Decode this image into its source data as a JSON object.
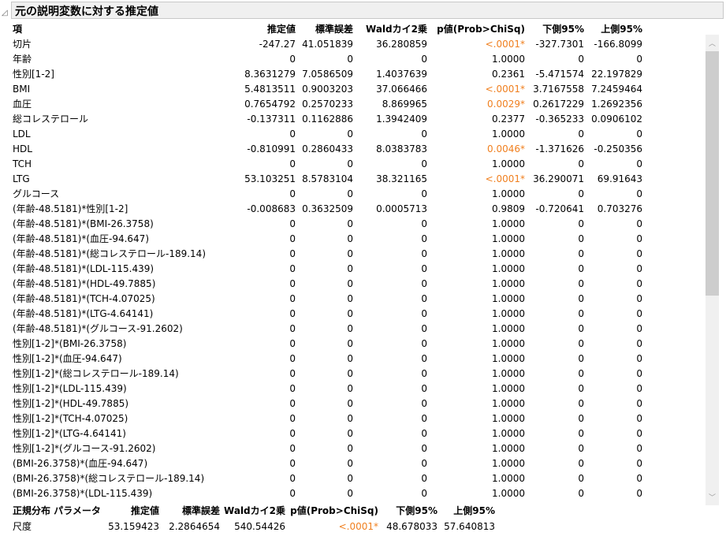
{
  "title": "元の説明変数に対する推定値",
  "columns": [
    "項",
    "推定値",
    "標準誤差",
    "Waldカイ2乗",
    "p値(Prob>ChiSq)",
    "下側95%",
    "上側95%"
  ],
  "rows": [
    [
      "切片",
      "-247.27",
      "41.051839",
      "36.280859",
      "<.0001*",
      "-327.7301",
      "-166.8099"
    ],
    [
      "年齢",
      "0",
      "0",
      "0",
      "1.0000",
      "0",
      "0"
    ],
    [
      "性別[1-2]",
      "8.3631279",
      "7.0586509",
      "1.4037639",
      "0.2361",
      "-5.471574",
      "22.197829"
    ],
    [
      "BMI",
      "5.4813511",
      "0.9003203",
      "37.066466",
      "<.0001*",
      "3.7167558",
      "7.2459464"
    ],
    [
      "血圧",
      "0.7654792",
      "0.2570233",
      "8.869965",
      "0.0029*",
      "0.2617229",
      "1.2692356"
    ],
    [
      "総コレステロール",
      "-0.137311",
      "0.1162886",
      "1.3942409",
      "0.2377",
      "-0.365233",
      "0.0906102"
    ],
    [
      "LDL",
      "0",
      "0",
      "0",
      "1.0000",
      "0",
      "0"
    ],
    [
      "HDL",
      "-0.810991",
      "0.2860433",
      "8.0383783",
      "0.0046*",
      "-1.371626",
      "-0.250356"
    ],
    [
      "TCH",
      "0",
      "0",
      "0",
      "1.0000",
      "0",
      "0"
    ],
    [
      "LTG",
      "53.103251",
      "8.5783104",
      "38.321165",
      "<.0001*",
      "36.290071",
      "69.91643"
    ],
    [
      "グルコース",
      "0",
      "0",
      "0",
      "1.0000",
      "0",
      "0"
    ],
    [
      "(年齢-48.5181)*性別[1-2]",
      "-0.008683",
      "0.3632509",
      "0.0005713",
      "0.9809",
      "-0.720641",
      "0.703276"
    ],
    [
      "(年齢-48.5181)*(BMI-26.3758)",
      "0",
      "0",
      "0",
      "1.0000",
      "0",
      "0"
    ],
    [
      "(年齢-48.5181)*(血圧-94.647)",
      "0",
      "0",
      "0",
      "1.0000",
      "0",
      "0"
    ],
    [
      "(年齢-48.5181)*(総コレステロール-189.14)",
      "0",
      "0",
      "0",
      "1.0000",
      "0",
      "0"
    ],
    [
      "(年齢-48.5181)*(LDL-115.439)",
      "0",
      "0",
      "0",
      "1.0000",
      "0",
      "0"
    ],
    [
      "(年齢-48.5181)*(HDL-49.7885)",
      "0",
      "0",
      "0",
      "1.0000",
      "0",
      "0"
    ],
    [
      "(年齢-48.5181)*(TCH-4.07025)",
      "0",
      "0",
      "0",
      "1.0000",
      "0",
      "0"
    ],
    [
      "(年齢-48.5181)*(LTG-4.64141)",
      "0",
      "0",
      "0",
      "1.0000",
      "0",
      "0"
    ],
    [
      "(年齢-48.5181)*(グルコース-91.2602)",
      "0",
      "0",
      "0",
      "1.0000",
      "0",
      "0"
    ],
    [
      "性別[1-2]*(BMI-26.3758)",
      "0",
      "0",
      "0",
      "1.0000",
      "0",
      "0"
    ],
    [
      "性別[1-2]*(血圧-94.647)",
      "0",
      "0",
      "0",
      "1.0000",
      "0",
      "0"
    ],
    [
      "性別[1-2]*(総コレステロール-189.14)",
      "0",
      "0",
      "0",
      "1.0000",
      "0",
      "0"
    ],
    [
      "性別[1-2]*(LDL-115.439)",
      "0",
      "0",
      "0",
      "1.0000",
      "0",
      "0"
    ],
    [
      "性別[1-2]*(HDL-49.7885)",
      "0",
      "0",
      "0",
      "1.0000",
      "0",
      "0"
    ],
    [
      "性別[1-2]*(TCH-4.07025)",
      "0",
      "0",
      "0",
      "1.0000",
      "0",
      "0"
    ],
    [
      "性別[1-2]*(LTG-4.64141)",
      "0",
      "0",
      "0",
      "1.0000",
      "0",
      "0"
    ],
    [
      "性別[1-2]*(グルコース-91.2602)",
      "0",
      "0",
      "0",
      "1.0000",
      "0",
      "0"
    ],
    [
      "(BMI-26.3758)*(血圧-94.647)",
      "0",
      "0",
      "0",
      "1.0000",
      "0",
      "0"
    ],
    [
      "(BMI-26.3758)*(総コレステロール-189.14)",
      "0",
      "0",
      "0",
      "1.0000",
      "0",
      "0"
    ],
    [
      "(BMI-26.3758)*(LDL-115.439)",
      "0",
      "0",
      "0",
      "1.0000",
      "0",
      "0"
    ]
  ],
  "dist": {
    "columns": [
      "正規分布 パラメータ",
      "推定値",
      "標準誤差",
      "Waldカイ2乗",
      "p値(Prob>ChiSq)",
      "下側95%",
      "上側95%"
    ],
    "row": [
      "尺度",
      "53.159423",
      "2.2864654",
      "540.54426",
      "<.0001*",
      "48.678033",
      "57.640813"
    ]
  },
  "colors": {
    "significant": "#f08020"
  }
}
